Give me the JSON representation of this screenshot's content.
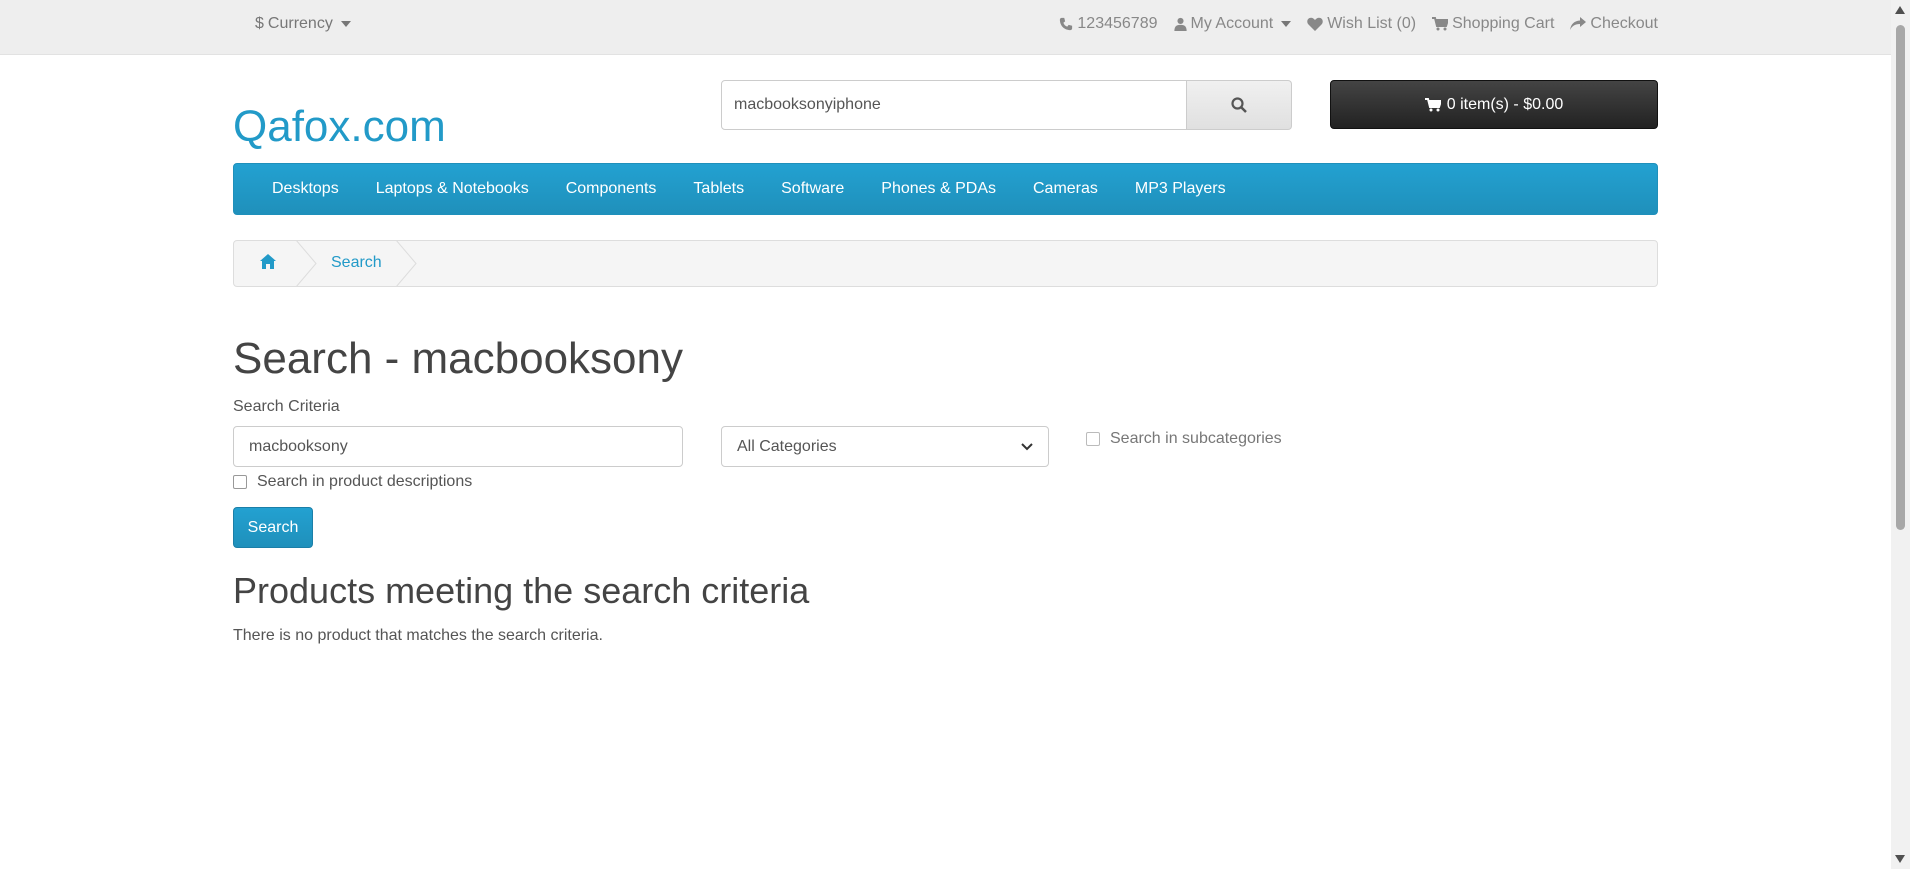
{
  "topbar": {
    "currency_symbol": "$",
    "currency_label": "Currency",
    "phone": "123456789",
    "my_account": "My Account",
    "wishlist": "Wish List (0)",
    "shopping_cart": "Shopping Cart",
    "checkout": "Checkout"
  },
  "header": {
    "logo": "Qafox.com",
    "search_value": "macbooksonyiphone",
    "cart_label": "0 item(s) - $0.00"
  },
  "menu": {
    "items": [
      "Desktops",
      "Laptops & Notebooks",
      "Components",
      "Tablets",
      "Software",
      "Phones & PDAs",
      "Cameras",
      "MP3 Players"
    ]
  },
  "breadcrumb": {
    "search": "Search"
  },
  "main": {
    "title": "Search - macbooksony",
    "criteria_label": "Search Criteria",
    "criteria_value": "macbooksony",
    "category_selected": "All Categories",
    "subcategories_label": "Search in subcategories",
    "descriptions_label": "Search in product descriptions",
    "search_button": "Search",
    "results_title": "Products meeting the search criteria",
    "empty_message": "There is no product that matches the search criteria."
  },
  "colors": {
    "brand": "#229ac8",
    "menu_bg": "#229ac8",
    "cart_bg": "#333333"
  },
  "icons": {
    "phone": "phone-icon",
    "account": "user-icon",
    "wishlist": "heart-icon",
    "cart": "cart-icon",
    "checkout": "share-icon",
    "search": "search-icon",
    "home": "home-icon"
  }
}
